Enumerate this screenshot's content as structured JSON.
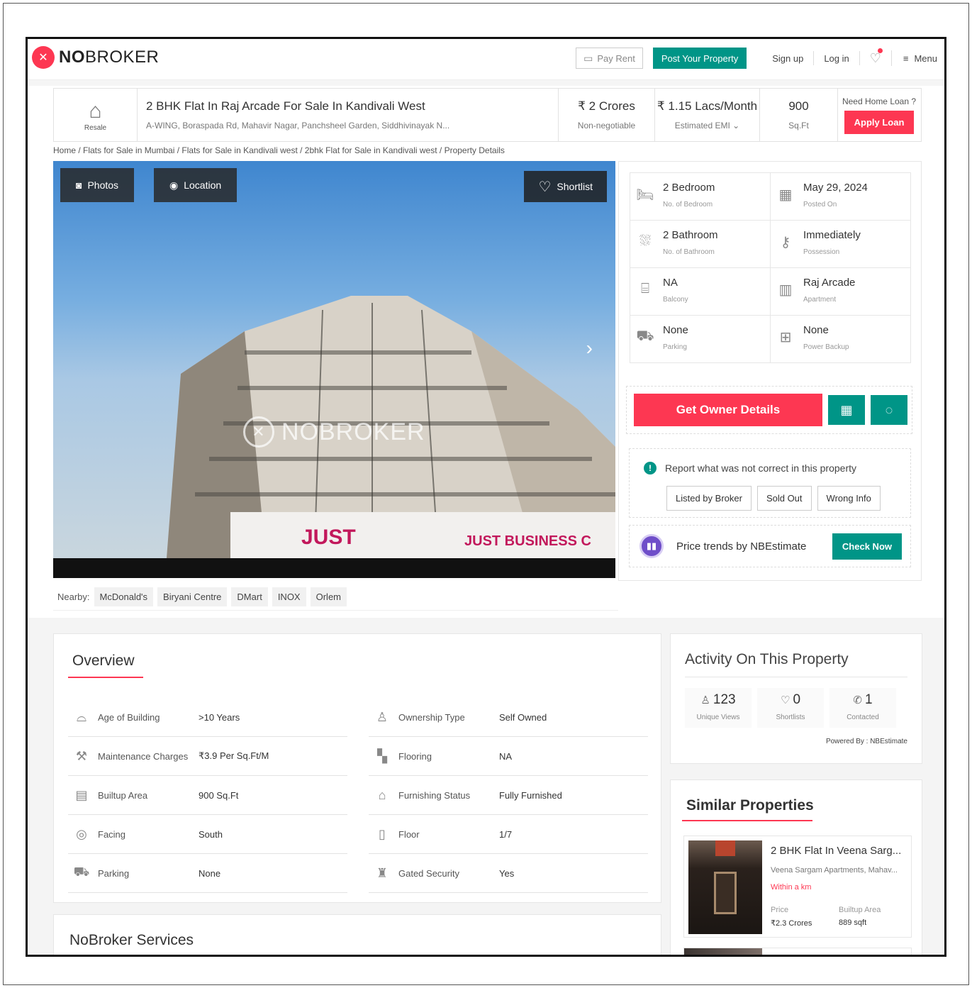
{
  "header": {
    "brand_prefix": "NO",
    "brand_suffix": "BROKER",
    "pay_rent": "Pay Rent",
    "post_property": "Post Your Property",
    "sign_up": "Sign up",
    "log_in": "Log in",
    "menu": "Menu"
  },
  "listing": {
    "badge": "Resale",
    "title": "2 BHK Flat In Raj Arcade For Sale In Kandivali West",
    "address": "A-WING, Boraspada Rd, Mahavir Nagar, Panchsheel Garden, Siddhivinayak N...",
    "price": "₹ 2 Crores",
    "price_note": "Non-negotiable",
    "emi": "₹ 1.15 Lacs/Month",
    "emi_note": "Estimated EMI",
    "area": "900",
    "area_unit": "Sq.Ft",
    "loan_prompt": "Need Home Loan ?",
    "apply_loan": "Apply Loan"
  },
  "breadcrumb": "Home / Flats for Sale in Mumbai / Flats for Sale in Kandivali west / 2bhk Flat for Sale in Kandivali west / Property Details",
  "gallery": {
    "photos": "Photos",
    "location": "Location",
    "shortlist": "Shortlist",
    "watermark": "NOBROKER",
    "sign_left": "JUST",
    "sign_right": "JUST BUSINESS C"
  },
  "nearby": {
    "label": "Nearby:",
    "items": [
      "McDonald's",
      "Biryani Centre",
      "DMart",
      "INOX",
      "Orlem"
    ]
  },
  "facts": [
    {
      "icon": "bed-icon",
      "value": "2 Bedroom",
      "label": "No. of Bedroom"
    },
    {
      "icon": "calendar-icon",
      "value": "May 29, 2024",
      "label": "Posted On"
    },
    {
      "icon": "bathtub-icon",
      "value": "2 Bathroom",
      "label": "No. of Bathroom"
    },
    {
      "icon": "key-icon",
      "value": "Immediately",
      "label": "Possession"
    },
    {
      "icon": "balcony-icon",
      "value": "NA",
      "label": "Balcony"
    },
    {
      "icon": "apartment-icon",
      "value": "Raj Arcade",
      "label": "Apartment"
    },
    {
      "icon": "car-icon",
      "value": "None",
      "label": "Parking"
    },
    {
      "icon": "power-icon",
      "value": "None",
      "label": "Power Backup"
    }
  ],
  "cta": {
    "get_owner": "Get Owner Details"
  },
  "report": {
    "prompt": "Report what was not correct in this property",
    "options": [
      "Listed by Broker",
      "Sold Out",
      "Wrong Info"
    ]
  },
  "trend": {
    "text": "Price trends by NBEstimate",
    "button": "Check Now"
  },
  "overview": {
    "title": "Overview",
    "left": [
      {
        "key": "Age of Building",
        "value": ">10 Years"
      },
      {
        "key": "Maintenance Charges",
        "value": "₹3.9 Per Sq.Ft/M"
      },
      {
        "key": "Builtup Area",
        "value": "900 Sq.Ft"
      },
      {
        "key": "Facing",
        "value": "South"
      },
      {
        "key": "Parking",
        "value": "None"
      }
    ],
    "right": [
      {
        "key": "Ownership Type",
        "value": "Self Owned"
      },
      {
        "key": "Flooring",
        "value": "NA"
      },
      {
        "key": "Furnishing Status",
        "value": "Fully Furnished"
      },
      {
        "key": "Floor",
        "value": "1/7"
      },
      {
        "key": "Gated Security",
        "value": "Yes"
      }
    ]
  },
  "services": {
    "title": "NoBroker Services"
  },
  "activity": {
    "title": "Activity On This Property",
    "views": "123",
    "views_label": "Unique Views",
    "shortlists": "0",
    "shortlists_label": "Shortlists",
    "contacted": "1",
    "contacted_label": "Contacted",
    "powered": "Powered By : NBEstimate"
  },
  "similar": {
    "title": "Similar Properties",
    "card": {
      "title": "2 BHK Flat In Veena Sarg...",
      "subtitle": "Veena Sargam Apartments, Mahav...",
      "distance": "Within a km",
      "price_label": "Price",
      "price": "₹2.3 Crores",
      "area_label": "Builtup Area",
      "area": "889 sqft"
    }
  },
  "colors": {
    "brand_red": "#fd3752",
    "brand_teal": "#009587"
  }
}
